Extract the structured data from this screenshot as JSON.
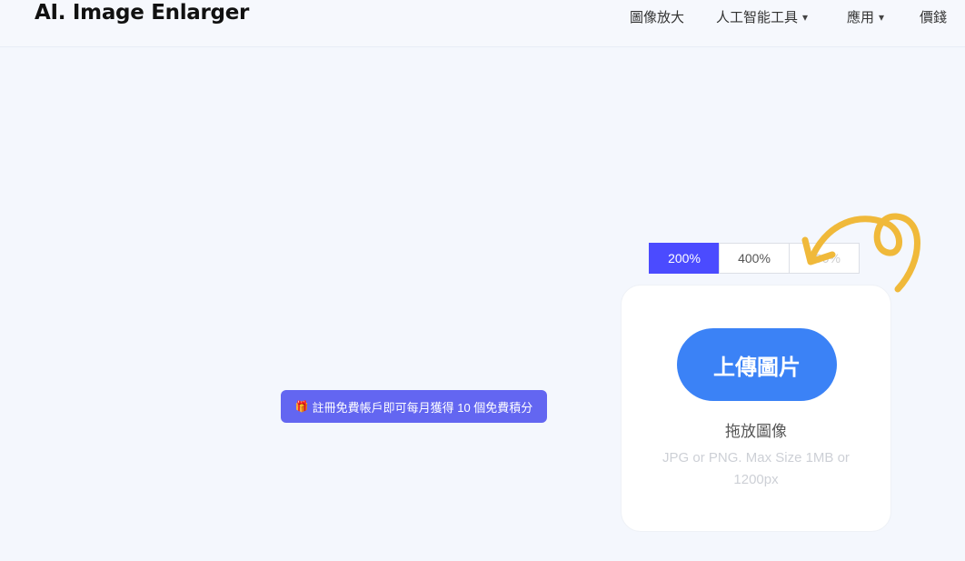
{
  "header": {
    "logo": "AI. Image Enlarger",
    "nav": [
      {
        "label": "圖像放大",
        "caret": ""
      },
      {
        "label": "人工智能工具",
        "caret": "▾"
      },
      {
        "label": "應用",
        "caret": "▾"
      },
      {
        "label": "價錢",
        "caret": ""
      }
    ]
  },
  "scale_options": [
    {
      "label": "200%",
      "active": true
    },
    {
      "label": "400%",
      "active": false
    },
    {
      "label": "800%",
      "active": false
    }
  ],
  "upload": {
    "button_label": "上傳圖片",
    "drop_label": "拖放圖像",
    "hint": "JPG or PNG. Max Size 1MB or 1200px"
  },
  "promo": {
    "icon": "gift-icon",
    "text": "註冊免費帳戶即可每月獲得 10 個免費積分"
  },
  "colors": {
    "background": "#f4f7fd",
    "accent_purple": "#4b4bff",
    "upload_blue": "#3b82f6",
    "promo_indigo": "#6366f1",
    "arrow_yellow": "#f0b93a"
  }
}
